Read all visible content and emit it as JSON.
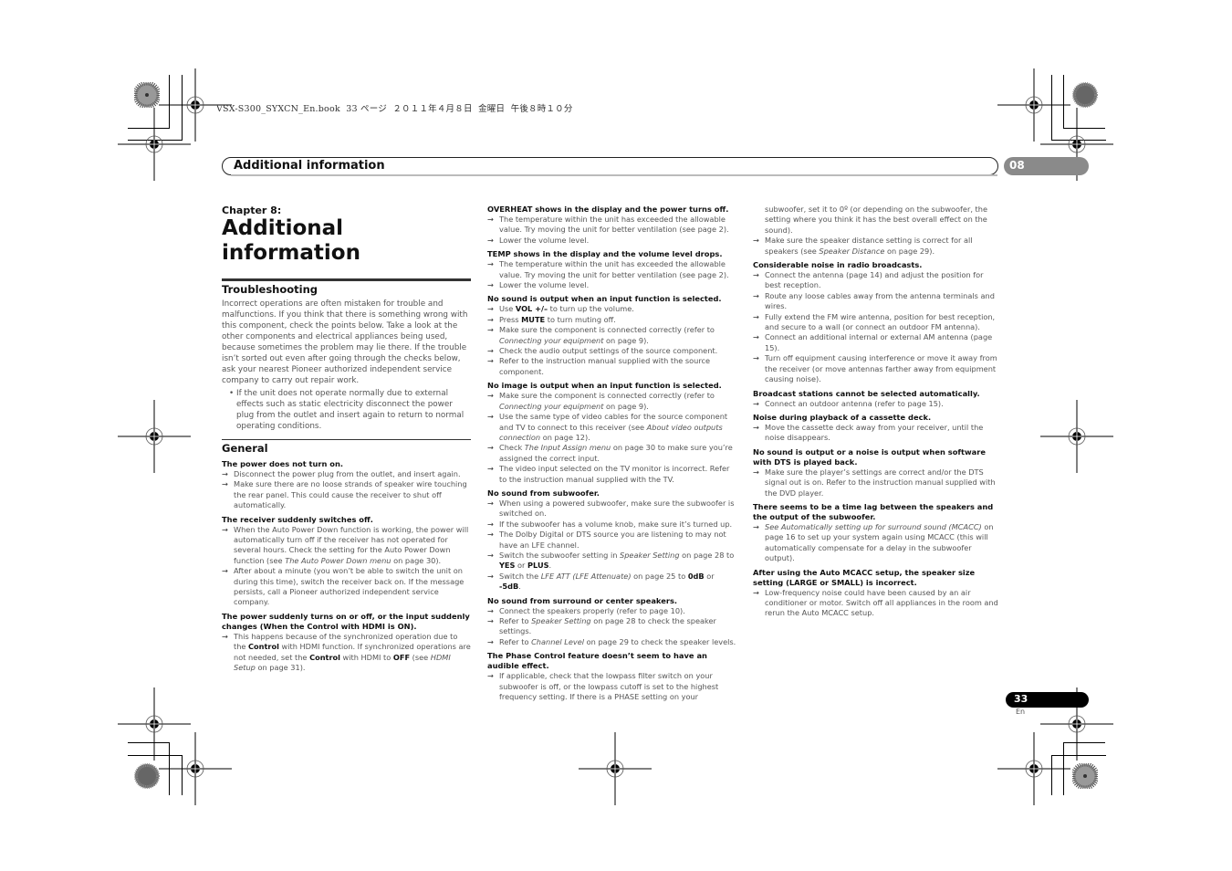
{
  "slug": "VSX-S300_SYXCN_En.book  33 ページ  ２０１１年４月８日  金曜日  午後８時１０分",
  "header": {
    "title": "Additional information",
    "chapter_number": "08"
  },
  "footer": {
    "page_number": "33",
    "language": "En"
  },
  "icons": {
    "bullet_arrow": "→"
  },
  "chapter": {
    "label": "Chapter 8:",
    "title": "Additional information"
  },
  "troubleshooting": {
    "heading": "Troubleshooting",
    "intro": "Incorrect operations are often mistaken for trouble and malfunctions. If you think that there is something wrong with this component, check the points below. Take a look at the other components and electrical appliances being used, because sometimes the problem may lie there. If the trouble isn’t sorted out even after going through the checks below, ask your nearest Pioneer authorized independent service company to carry out repair work.",
    "bullet": "If the unit does not operate normally due to external effects such as static electricity disconnect the power plug from the outlet and insert again to return to normal operating conditions."
  },
  "general": {
    "heading": "General",
    "items": [
      {
        "q": "The power does not turn on.",
        "a": [
          "Disconnect the power plug from the outlet, and insert again.",
          "Make sure there are no loose strands of speaker wire touching the rear panel. This could cause the receiver to shut off automatically."
        ]
      },
      {
        "q": "The receiver suddenly switches off.",
        "a": [
          "When the Auto Power Down function is working, the power will automatically turn off if the receiver has not operated for several hours. Check the setting for the Auto Power Down function (see <i>The Auto Power Down menu</i> on page 30).",
          "After about a minute (you won’t be able to switch the unit on during this time), switch the receiver back on. If the message persists, call a Pioneer authorized independent service company."
        ]
      },
      {
        "q": "The power suddenly turns on or off, or the input suddenly changes (When the Control with HDMI is ON).",
        "a": [
          "This happens because of the synchronized operation due to the <b>Control</b> with HDMI function. If synchronized operations are not needed, set the <b>Control</b> with HDMI to <b>OFF</b> (see <i>HDMI Setup</i> on page 31)."
        ]
      }
    ]
  },
  "column2": [
    {
      "q": "OVERHEAT shows in the display and the power turns off.",
      "a": [
        "The temperature within the unit has exceeded the allowable value. Try moving the unit for better ventilation (see page 2).",
        "Lower the volume level."
      ]
    },
    {
      "q": "TEMP shows in the display and the volume level drops.",
      "a": [
        "The temperature within the unit has exceeded the allowable value. Try moving the unit for better ventilation (see page 2).",
        "Lower the volume level."
      ]
    },
    {
      "q": "No sound is output when an input function is selected.",
      "a": [
        "Use <b>VOL +/–</b> to turn up the volume.",
        "Press <b>MUTE</b> to turn muting off.",
        "Make sure the component is connected correctly (refer to <i>Connecting your equipment</i> on page 9).",
        "Check the audio output settings of the source component.",
        "Refer to the instruction manual supplied with the source component."
      ]
    },
    {
      "q": "No image is output when an input function is selected.",
      "a": [
        "Make sure the component is connected correctly (refer to <i>Connecting your equipment</i> on page 9).",
        "Use the same type of video cables for the source component and TV to connect to this receiver (see <i>About video outputs connection</i> on page 12).",
        "Check <i>The Input Assign menu</i> on page 30 to make sure you’re assigned the correct input.",
        "The video input selected on the TV monitor is incorrect. Refer to the instruction manual supplied with the TV."
      ]
    },
    {
      "q": "No sound from subwoofer.",
      "a": [
        "When using a powered subwoofer, make sure the subwoofer is switched on.",
        "If the subwoofer has a volume knob, make sure it’s turned up.",
        "The Dolby Digital or DTS source you are listening to may not have an LFE channel.",
        "Switch the subwoofer setting in <i>Speaker Setting</i> on page 28 to <b>YES</b> or <b>PLUS</b>.",
        "Switch the <i>LFE ATT (LFE Attenuate)</i> on page 25 to <b>0dB</b> or <b>-5dB</b>."
      ]
    },
    {
      "q": "No sound from surround or center speakers.",
      "a": [
        "Connect the speakers properly (refer to page 10).",
        "Refer to <i>Speaker Setting</i> on page 28 to check the speaker settings.",
        "Refer to <i>Channel Level</i> on page 29 to check the speaker levels."
      ]
    },
    {
      "q": "The Phase Control feature doesn’t seem to have an audible effect.",
      "a": [
        "If applicable, check that the lowpass filter switch on your subwoofer is off, or the lowpass cutoff is set to the highest frequency setting. If there is a PHASE setting on your"
      ]
    }
  ],
  "column3_continuation": "subwoofer, set it to 0º (or depending on the subwoofer, the setting where you think it has the best overall effect on the sound).",
  "column3": [
    {
      "q": "",
      "a": [
        "Make sure the speaker distance setting is correct for all speakers (see <i>Speaker Distance</i> on page 29)."
      ]
    },
    {
      "q": "Considerable noise in radio broadcasts.",
      "a": [
        "Connect the antenna (page 14) and adjust the position for best reception.",
        "Route any loose cables away from the antenna terminals and wires.",
        "Fully extend the FM wire antenna, position for best reception, and secure to a wall (or connect an outdoor FM antenna).",
        "Connect an additional internal or external AM antenna (page 15).",
        "Turn off equipment causing interference or move it away from the receiver (or move antennas farther away from equipment causing noise)."
      ]
    },
    {
      "q": "Broadcast stations cannot be selected automatically.",
      "a": [
        "Connect an outdoor antenna (refer to page 15)."
      ]
    },
    {
      "q": "Noise during playback of a cassette deck.",
      "a": [
        "Move the cassette deck away from your receiver, until the noise disappears."
      ]
    },
    {
      "q": "No sound is output or a noise is output when software with DTS is played back.",
      "a": [
        "Make sure the player’s settings are correct and/or the DTS signal out is on. Refer to the instruction manual supplied with the DVD player."
      ]
    },
    {
      "q": "There seems to be a time lag between the speakers and the output of the subwoofer.",
      "a": [
        "<i>See Automatically setting up for surround sound (MCACC)</i> on page 16 to set up your system again using MCACC (this will automatically compensate for a delay in the subwoofer output)."
      ]
    },
    {
      "q": "After using the Auto MCACC setup, the speaker size setting (LARGE or SMALL) is incorrect.",
      "a": [
        "Low-frequency noise could have been caused by an air conditioner or motor. Switch off all appliances in the room and rerun the Auto MCACC setup."
      ]
    }
  ]
}
